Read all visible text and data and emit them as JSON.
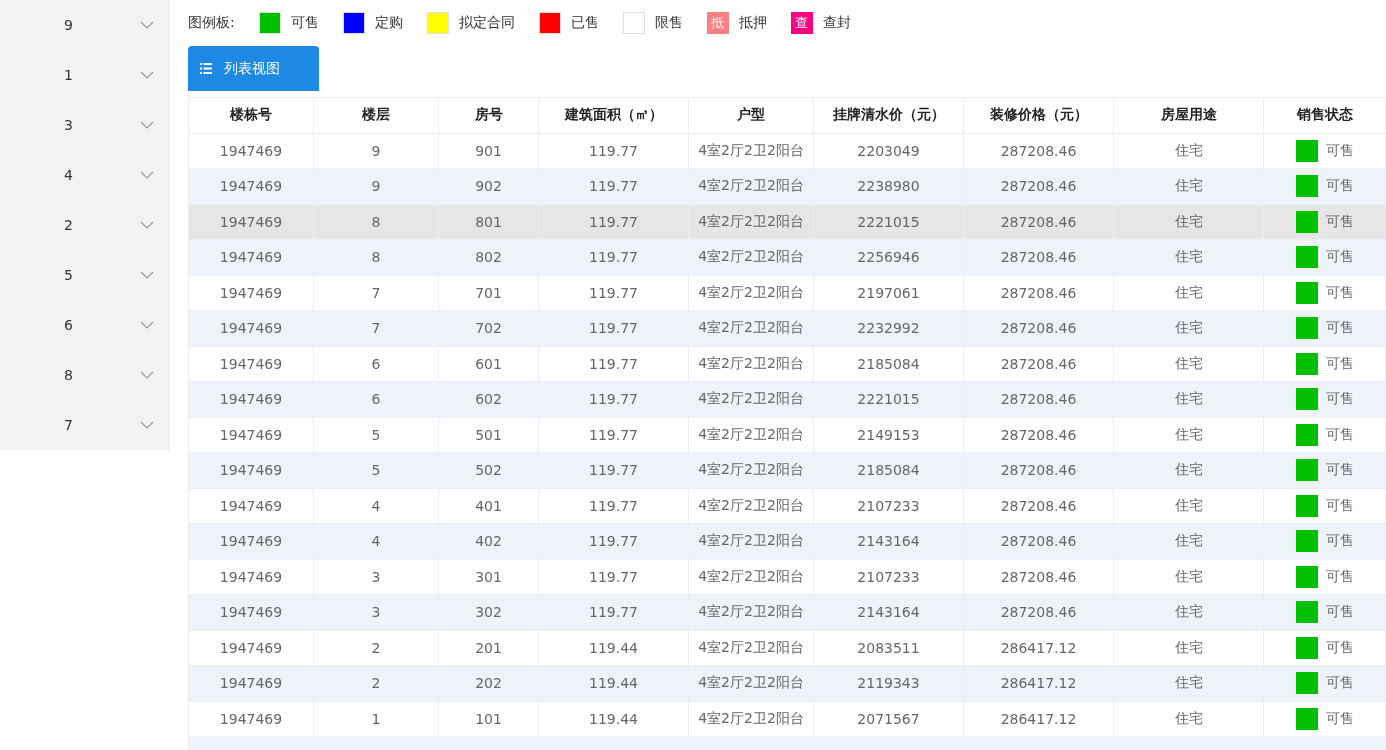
{
  "sidebar": {
    "items": [
      {
        "label": "9",
        "expanded": false
      },
      {
        "label": "1",
        "expanded": false
      },
      {
        "label": "3",
        "expanded": false
      },
      {
        "label": "4",
        "expanded": false
      },
      {
        "label": "2",
        "expanded": false
      },
      {
        "label": "5",
        "expanded": false
      },
      {
        "label": "6",
        "expanded": false
      },
      {
        "label": "8",
        "expanded": false
      },
      {
        "label": "7",
        "expanded": false
      }
    ]
  },
  "legend": {
    "title": "图例板:",
    "items": [
      {
        "kind": "swatch",
        "color": "#00c000",
        "label": "可售"
      },
      {
        "kind": "swatch",
        "color": "#0000ff",
        "label": "定购"
      },
      {
        "kind": "swatch",
        "color": "#ffff00",
        "label": "拟定合同"
      },
      {
        "kind": "swatch",
        "color": "#ff0000",
        "label": "已售"
      },
      {
        "kind": "swatch",
        "color": "#ffffff",
        "label": "限售"
      },
      {
        "kind": "badge",
        "color": "#ff7f7f",
        "mark": "抵",
        "label": "抵押"
      },
      {
        "kind": "badge",
        "color": "#ff0080",
        "mark": "查",
        "label": "查封"
      }
    ]
  },
  "view_button": {
    "label": "列表视图"
  },
  "table": {
    "columns": [
      "楼栋号",
      "楼层",
      "房号",
      "建筑面积（㎡）",
      "户型",
      "挂牌清水价（元）",
      "装修价格（元）",
      "房屋用途",
      "销售状态"
    ],
    "rows": [
      {
        "cells": [
          "1947469",
          "9",
          "901",
          "119.77",
          "4室2厅2卫2阳台",
          "2203049",
          "287208.46",
          "住宅"
        ],
        "status": "可售",
        "color": "#00c000",
        "selected": false
      },
      {
        "cells": [
          "1947469",
          "9",
          "902",
          "119.77",
          "4室2厅2卫2阳台",
          "2238980",
          "287208.46",
          "住宅"
        ],
        "status": "可售",
        "color": "#00c000",
        "selected": false
      },
      {
        "cells": [
          "1947469",
          "8",
          "801",
          "119.77",
          "4室2厅2卫2阳台",
          "2221015",
          "287208.46",
          "住宅"
        ],
        "status": "可售",
        "color": "#00c000",
        "selected": true
      },
      {
        "cells": [
          "1947469",
          "8",
          "802",
          "119.77",
          "4室2厅2卫2阳台",
          "2256946",
          "287208.46",
          "住宅"
        ],
        "status": "可售",
        "color": "#00c000",
        "selected": false
      },
      {
        "cells": [
          "1947469",
          "7",
          "701",
          "119.77",
          "4室2厅2卫2阳台",
          "2197061",
          "287208.46",
          "住宅"
        ],
        "status": "可售",
        "color": "#00c000",
        "selected": false
      },
      {
        "cells": [
          "1947469",
          "7",
          "702",
          "119.77",
          "4室2厅2卫2阳台",
          "2232992",
          "287208.46",
          "住宅"
        ],
        "status": "可售",
        "color": "#00c000",
        "selected": false
      },
      {
        "cells": [
          "1947469",
          "6",
          "601",
          "119.77",
          "4室2厅2卫2阳台",
          "2185084",
          "287208.46",
          "住宅"
        ],
        "status": "可售",
        "color": "#00c000",
        "selected": false
      },
      {
        "cells": [
          "1947469",
          "6",
          "602",
          "119.77",
          "4室2厅2卫2阳台",
          "2221015",
          "287208.46",
          "住宅"
        ],
        "status": "可售",
        "color": "#00c000",
        "selected": false
      },
      {
        "cells": [
          "1947469",
          "5",
          "501",
          "119.77",
          "4室2厅2卫2阳台",
          "2149153",
          "287208.46",
          "住宅"
        ],
        "status": "可售",
        "color": "#00c000",
        "selected": false
      },
      {
        "cells": [
          "1947469",
          "5",
          "502",
          "119.77",
          "4室2厅2卫2阳台",
          "2185084",
          "287208.46",
          "住宅"
        ],
        "status": "可售",
        "color": "#00c000",
        "selected": false
      },
      {
        "cells": [
          "1947469",
          "4",
          "401",
          "119.77",
          "4室2厅2卫2阳台",
          "2107233",
          "287208.46",
          "住宅"
        ],
        "status": "可售",
        "color": "#00c000",
        "selected": false
      },
      {
        "cells": [
          "1947469",
          "4",
          "402",
          "119.77",
          "4室2厅2卫2阳台",
          "2143164",
          "287208.46",
          "住宅"
        ],
        "status": "可售",
        "color": "#00c000",
        "selected": false
      },
      {
        "cells": [
          "1947469",
          "3",
          "301",
          "119.77",
          "4室2厅2卫2阳台",
          "2107233",
          "287208.46",
          "住宅"
        ],
        "status": "可售",
        "color": "#00c000",
        "selected": false
      },
      {
        "cells": [
          "1947469",
          "3",
          "302",
          "119.77",
          "4室2厅2卫2阳台",
          "2143164",
          "287208.46",
          "住宅"
        ],
        "status": "可售",
        "color": "#00c000",
        "selected": false
      },
      {
        "cells": [
          "1947469",
          "2",
          "201",
          "119.44",
          "4室2厅2卫2阳台",
          "2083511",
          "286417.12",
          "住宅"
        ],
        "status": "可售",
        "color": "#00c000",
        "selected": false
      },
      {
        "cells": [
          "1947469",
          "2",
          "202",
          "119.44",
          "4室2厅2卫2阳台",
          "2119343",
          "286417.12",
          "住宅"
        ],
        "status": "可售",
        "color": "#00c000",
        "selected": false
      },
      {
        "cells": [
          "1947469",
          "1",
          "101",
          "119.44",
          "4室2厅2卫2阳台",
          "2071567",
          "286417.12",
          "住宅"
        ],
        "status": "可售",
        "color": "#00c000",
        "selected": false
      }
    ]
  }
}
